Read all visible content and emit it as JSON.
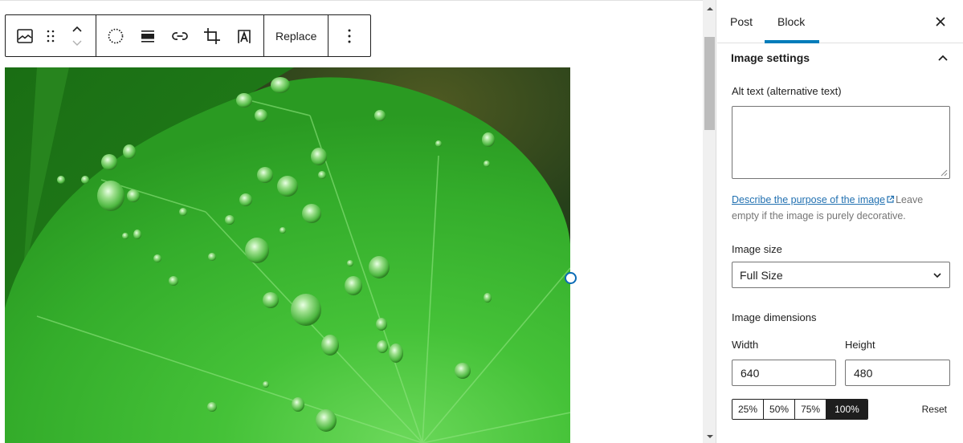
{
  "toolbar": {
    "block_type_icon": "image-icon",
    "drag_handle_icon": "drag-handle-icon",
    "move_up_icon": "chevron-up-icon",
    "move_down_icon": "chevron-down-icon",
    "tools": [
      {
        "name": "duotone",
        "icon": "dotted-circle-icon"
      },
      {
        "name": "align",
        "icon": "align-wide-icon"
      },
      {
        "name": "link",
        "icon": "link-icon"
      },
      {
        "name": "crop",
        "icon": "crop-icon"
      },
      {
        "name": "text-overlay",
        "icon": "text-overlay-icon"
      }
    ],
    "replace_label": "Replace",
    "more_icon": "more-vertical-icon"
  },
  "image": {
    "subject": "Green leaf with water droplets",
    "colors": {
      "leaf": "#3cb531",
      "dark_leaf": "#1f6b16",
      "background": "#2f4a1a"
    }
  },
  "sidebar": {
    "tabs": [
      {
        "label": "Post",
        "active": false
      },
      {
        "label": "Block",
        "active": true
      }
    ],
    "close_icon": "close-icon",
    "panel": {
      "title": "Image settings",
      "expanded": true,
      "alt_text": {
        "label": "Alt text (alternative text)",
        "value": "",
        "help_link": "Describe the purpose of the image",
        "help_rest": "Leave empty if the image is purely decorative."
      },
      "image_size": {
        "label": "Image size",
        "selected": "Full Size"
      },
      "dimensions": {
        "label": "Image dimensions",
        "width_label": "Width",
        "width_value": "640",
        "height_label": "Height",
        "height_value": "480",
        "presets": [
          "25%",
          "50%",
          "75%",
          "100%"
        ],
        "active_preset": "100%",
        "reset_label": "Reset"
      }
    }
  },
  "colors": {
    "accent": "#007cba",
    "link": "#2271b1",
    "text": "#1e1e1e",
    "muted": "#757575"
  }
}
